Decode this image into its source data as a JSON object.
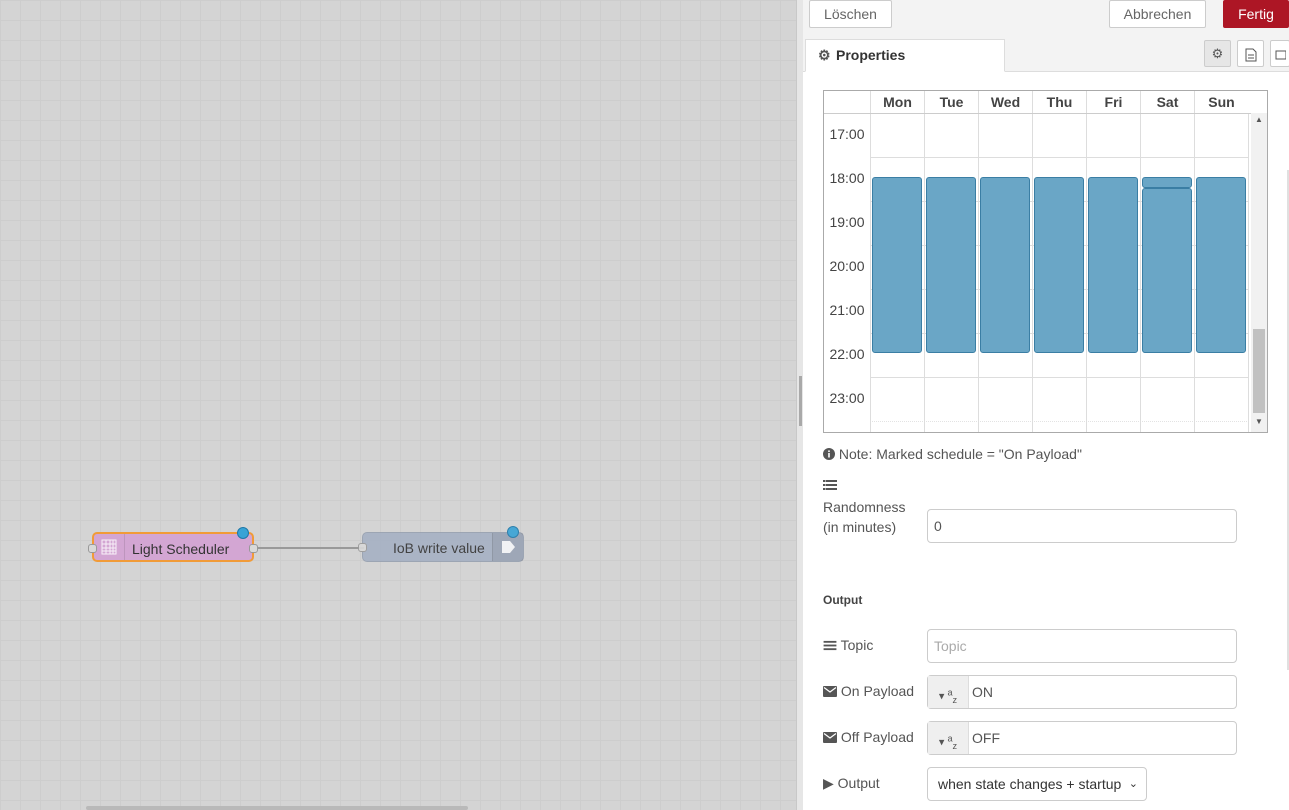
{
  "toolbar": {
    "delete_label": "Löschen",
    "cancel_label": "Abbrechen",
    "done_label": "Fertig"
  },
  "tabs": {
    "properties_label": "Properties",
    "settings_icon": "gear-icon",
    "description_icon": "file-text-icon",
    "appearance_icon": "object-icon"
  },
  "flow": {
    "nodes": [
      {
        "label": "Light Scheduler",
        "icon": "calendar-grid-icon"
      },
      {
        "label": "IoB write value",
        "icon": "arrow-out-icon"
      }
    ]
  },
  "schedule": {
    "days": [
      "Mon",
      "Tue",
      "Wed",
      "Thu",
      "Fri",
      "Sat",
      "Sun"
    ],
    "times": [
      "17:00",
      "18:00",
      "19:00",
      "20:00",
      "21:00",
      "22:00",
      "23:00"
    ],
    "events": [
      {
        "day": "Mon",
        "start": "17:45",
        "end": "21:45"
      },
      {
        "day": "Tue",
        "start": "17:45",
        "end": "21:45"
      },
      {
        "day": "Wed",
        "start": "17:45",
        "end": "21:45"
      },
      {
        "day": "Thu",
        "start": "17:45",
        "end": "21:45"
      },
      {
        "day": "Fri",
        "start": "17:45",
        "end": "21:45"
      },
      {
        "day": "Sat",
        "start": "17:45",
        "end": "18:00"
      },
      {
        "day": "Sat",
        "start": "18:00",
        "end": "21:45"
      },
      {
        "day": "Sun",
        "start": "17:45",
        "end": "21:45"
      }
    ],
    "event_color": "#6aa6c6"
  },
  "note": {
    "text": "Note: Marked schedule = \"On Payload\""
  },
  "randomness": {
    "label_line1": "Randomness",
    "label_line2": "(in minutes)",
    "value": "0"
  },
  "output": {
    "heading": "Output",
    "topic_label": "Topic",
    "topic_placeholder": "Topic",
    "topic_value": "",
    "on_payload_label": "On Payload",
    "on_payload_value": "ON",
    "off_payload_label": "Off Payload",
    "off_payload_value": "OFF",
    "output_label": "Output",
    "output_selected": "when state changes + startup"
  },
  "colors": {
    "done_button": "#ad1625",
    "scheduler_node": "#d3a6d3",
    "iob_node": "#a6b1c4",
    "status_dot": "#38a3d6"
  }
}
